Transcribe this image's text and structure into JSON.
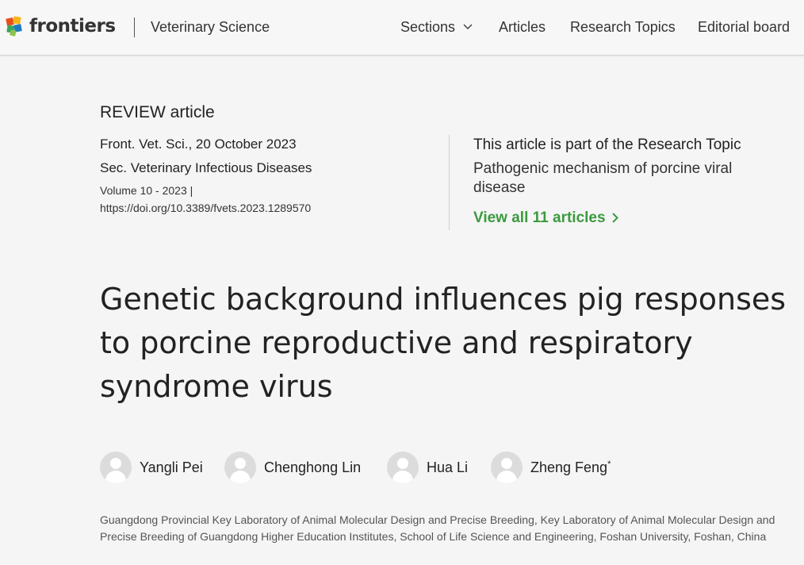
{
  "header": {
    "brand": "frontiers",
    "journal": "Veterinary Science",
    "nav": [
      "Sections",
      "Articles",
      "Research Topics",
      "Editorial board"
    ]
  },
  "article": {
    "type": "REVIEW article",
    "journal_date": "Front. Vet. Sci., 20 October 2023",
    "section": "Sec. Veterinary Infectious Diseases",
    "volume": "Volume 10 - 2023 |",
    "doi": "https://doi.org/10.3389/fvets.2023.1289570"
  },
  "research_topic": {
    "heading": "This article is part of the Research Topic",
    "name": "Pathogenic mechanism of porcine viral disease",
    "link": "View all 11 articles"
  },
  "title": "Genetic background influences pig responses to porcine reproductive and respiratory syndrome virus",
  "authors": [
    {
      "name": "Yangli Pei",
      "mark": ""
    },
    {
      "name": "Chenghong Lin",
      "mark": ""
    },
    {
      "name": "Hua Li",
      "mark": ""
    },
    {
      "name": "Zheng Feng",
      "mark": "*"
    }
  ],
  "affiliation": "Guangdong Provincial Key Laboratory of Animal Molecular Design and Precise Breeding, Key Laboratory of Animal Molecular Design and Precise Breeding of Guangdong Higher Education Institutes, School of Life Science and Engineering, Foshan University, Foshan, China",
  "colors": {
    "accent_green": "#3b9a3f"
  }
}
